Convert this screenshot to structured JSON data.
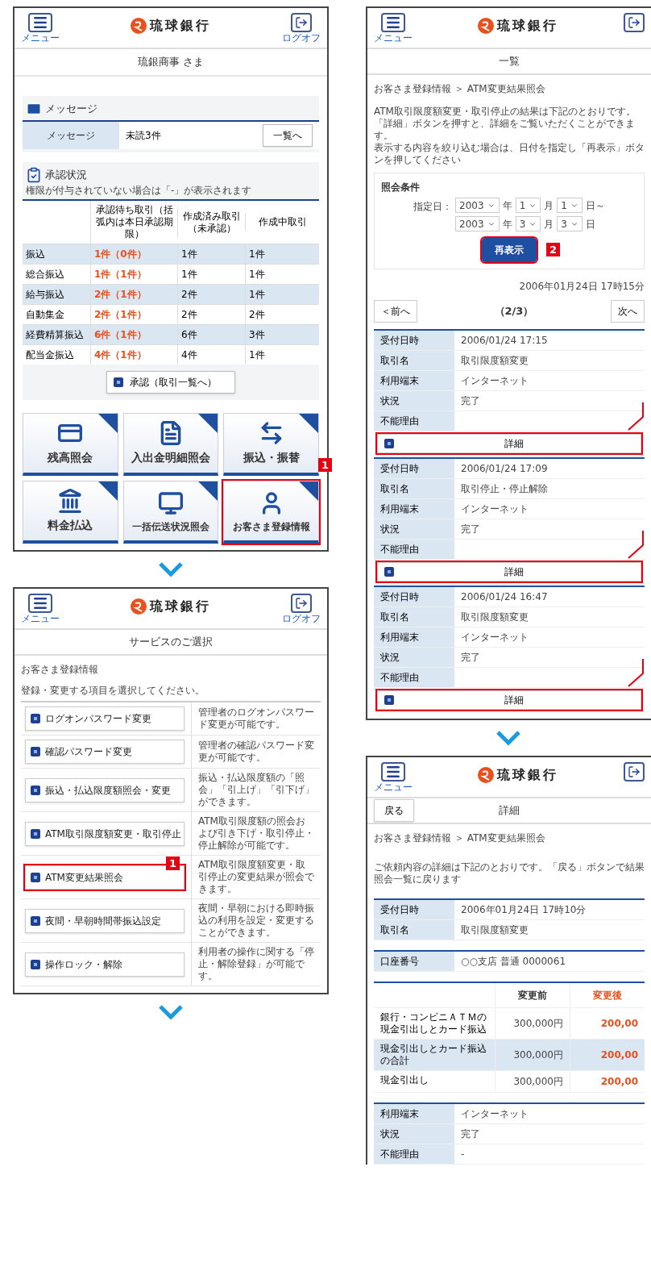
{
  "home": {
    "header": {
      "menu_label": "メニュー",
      "bank_name": "琉球銀行",
      "logoff_label": "ログオフ"
    },
    "greeting": "琉銀商事 さま",
    "messages": {
      "title": "メッセージ",
      "label": "メッセージ",
      "value": "未読3件",
      "button": "一覧へ"
    },
    "approval": {
      "title": "承認状況",
      "note": "権限が付与されていない場合は「-」が表示されます",
      "columns": [
        "承認待ち取引（括弧内は本日承認期限）",
        "作成済み取引（未承認）",
        "作成中取引"
      ],
      "rows": [
        {
          "name": "振込",
          "waiting": "1件（0件）",
          "created": "1件",
          "drafting": "1件"
        },
        {
          "name": "総合振込",
          "waiting": "1件（1件）",
          "created": "1件",
          "drafting": "1件"
        },
        {
          "name": "給与振込",
          "waiting": "2件（1件）",
          "created": "2件",
          "drafting": "1件"
        },
        {
          "name": "自動集金",
          "waiting": "2件（1件）",
          "created": "2件",
          "drafting": "2件"
        },
        {
          "name": "経費精算振込",
          "waiting": "6件（1件）",
          "created": "6件",
          "drafting": "3件"
        },
        {
          "name": "配当金振込",
          "waiting": "4件（1件）",
          "created": "4件",
          "drafting": "1件"
        }
      ],
      "button": "承認（取引一覧へ）"
    },
    "tiles": [
      {
        "label": "残高照会",
        "highlighted": false
      },
      {
        "label": "入出金明細照会",
        "highlighted": false
      },
      {
        "label": "振込・振替",
        "highlighted": false
      },
      {
        "label": "料金払込",
        "highlighted": false
      },
      {
        "label": "一括伝送状況照会",
        "highlighted": false
      },
      {
        "label": "お客さま登録情報",
        "highlighted": true,
        "callout": "1"
      }
    ]
  },
  "service": {
    "header": {
      "menu_label": "メニュー",
      "bank_name": "琉球銀行",
      "logoff_label": "ログオフ"
    },
    "title": "サービスのご選択",
    "section": "お客さま登録情報",
    "instruction": "登録・変更する項目を選択してください。",
    "items": [
      {
        "button": "ログオンパスワード変更",
        "description": "管理者のログオンパスワード変更が可能です。",
        "highlighted": false
      },
      {
        "button": "確認パスワード変更",
        "description": "管理者の確認パスワード変更が可能です。",
        "highlighted": false
      },
      {
        "button": "振込・払込限度額照会・変更",
        "description": "振込・払込限度額の「照会」「引上げ」「引下げ」ができます。",
        "highlighted": false
      },
      {
        "button": "ATM取引限度額変更・取引停止",
        "description": "ATM取引限度額の照会および引き下げ・取引停止・停止解除が可能です。",
        "highlighted": false
      },
      {
        "button": "ATM変更結果照会",
        "description": "ATM取引限度額変更・取引停止の変更結果が照会できます。",
        "highlighted": true,
        "callout": "1"
      },
      {
        "button": "夜間・早朝時間帯振込設定",
        "description": "夜間・早朝における即時振込の利用を設定・変更することができます。",
        "highlighted": false
      },
      {
        "button": "操作ロック・解除",
        "description": "利用者の操作に関する「停止・解除登録」が可能です。",
        "highlighted": false
      }
    ]
  },
  "list": {
    "header": {
      "menu_label": "メニュー",
      "bank_name": "琉球銀行"
    },
    "title": "一覧",
    "breadcrumb": "お客さま登録情報 ＞ ATM変更結果照会",
    "description": [
      "ATM取引限度額変更・取引停止の結果は下記のとおりです。",
      "「詳細」ボタンを押すと、詳細をご覧いただくことができます。",
      "表示する内容を絞り込む場合は、日付を指定し「再表示」ボタンを押してください"
    ],
    "filter": {
      "title": "照会条件",
      "date_label": "指定日：",
      "dates": [
        {
          "year": "2003",
          "year_unit": "年",
          "month": "1",
          "month_unit": "月",
          "day": "1",
          "suffix": "日～"
        },
        {
          "year": "2003",
          "year_unit": "年",
          "month": "3",
          "month_unit": "月",
          "day": "3",
          "suffix": "日"
        }
      ],
      "button": "再表示",
      "button_highlighted": true,
      "callout": "2"
    },
    "timestamp": "2006年01月24日 17時15分",
    "pager": {
      "prev": "＜前へ",
      "page": "（2/3）",
      "next": "次へ"
    },
    "records": [
      {
        "fields": [
          {
            "label": "受付日時",
            "value": "2006/01/24 17:15"
          },
          {
            "label": "取引名",
            "value": "取引限度額変更"
          },
          {
            "label": "利用端末",
            "value": "インターネット"
          },
          {
            "label": "状況",
            "value": "完了"
          },
          {
            "label": "不能理由"
          }
        ],
        "button": "詳細",
        "highlighted": true
      },
      {
        "fields": [
          {
            "label": "受付日時",
            "value": "2006/01/24 17:09"
          },
          {
            "label": "取引名",
            "value": "取引停止・停止解除"
          },
          {
            "label": "利用端末",
            "value": "インターネット"
          },
          {
            "label": "状況",
            "value": "完了"
          },
          {
            "label": "不能理由"
          }
        ],
        "button": "詳細",
        "highlighted": true
      },
      {
        "fields": [
          {
            "label": "受付日時",
            "value": "2006/01/24 16:47"
          },
          {
            "label": "取引名",
            "value": "取引限度額変更"
          },
          {
            "label": "利用端末",
            "value": "インターネット"
          },
          {
            "label": "状況",
            "value": "完了"
          },
          {
            "label": "不能理由"
          }
        ],
        "button": "詳細",
        "highlighted": true
      }
    ]
  },
  "detail": {
    "header": {
      "menu_label": "メニュー",
      "bank_name": "琉球銀行"
    },
    "back_button": "戻る",
    "title": "詳細",
    "breadcrumb": "お客さま登録情報 ＞ ATM変更結果照会",
    "description": "ご依頼内容の詳細は下記のとおりです。「戻る」ボタンで結果照会一覧に戻ります",
    "sections": [
      [
        {
          "label": "受付日時",
          "value": "2006年01月24日 17時10分"
        },
        {
          "label": "取引名",
          "value": "取引限度額変更"
        }
      ],
      [
        {
          "label": "口座番号",
          "value": "○○支店 普通 0000061"
        }
      ]
    ],
    "amounts": {
      "columns": [
        "変更前",
        "変更後"
      ],
      "rows": [
        {
          "label": "銀行・コンビニＡＴＭの現金引出しとカード振込",
          "before": "300,000円",
          "after": "200,00"
        },
        {
          "label": "現金引出しとカード振込の合計",
          "before": "300,000円",
          "after": "200,00"
        },
        {
          "label": "現金引出し",
          "before": "300,000円",
          "after": "200,00"
        }
      ]
    },
    "footer": [
      {
        "label": "利用端末",
        "value": "インターネット"
      },
      {
        "label": "状況",
        "value": "完了"
      },
      {
        "label": "不能理由",
        "value": "-"
      }
    ]
  }
}
